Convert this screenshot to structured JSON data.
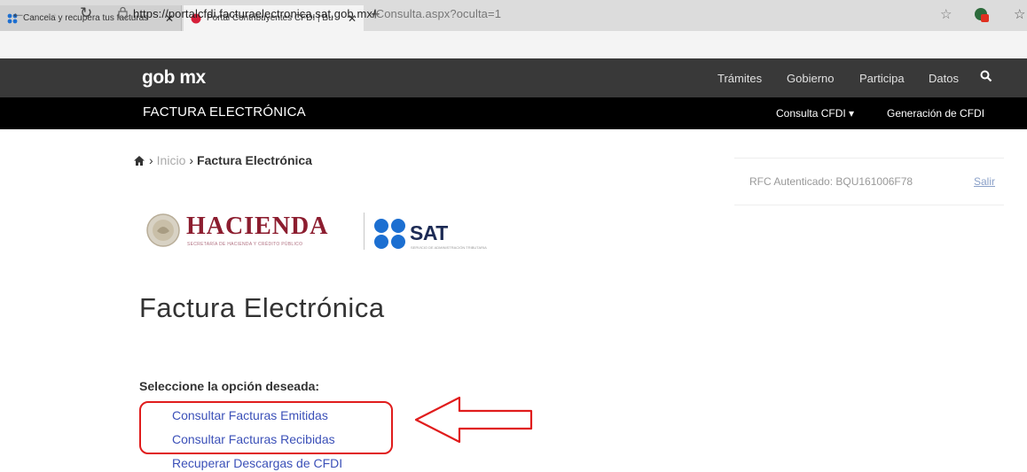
{
  "browser": {
    "tabs": [
      {
        "title": "Cancela y recupera tus facturas",
        "active": false
      },
      {
        "title": "Portal Contribuyentes CFDI | Bu",
        "active": true
      }
    ],
    "new_tab_label": "+",
    "url_main": "https://portalcfdi.facturaelectronica.sat.gob.mx/",
    "url_rest": "Consulta.aspx?oculta=1"
  },
  "gob": {
    "logo": "gob mx",
    "menu": [
      "Trámites",
      "Gobierno",
      "Participa",
      "Datos"
    ]
  },
  "subnav": {
    "title": "FACTURA ELECTRÓNICA",
    "menu": [
      "Consulta CFDI",
      "Generación de CFDI"
    ]
  },
  "breadcrumb": {
    "items": [
      "Inicio",
      "Factura Electrónica"
    ]
  },
  "session": {
    "rfc_text": "RFC Autenticado: BQU161006F78",
    "logout_label": "Salir"
  },
  "logos": {
    "hacienda": "HACIENDA",
    "hacienda_sub": "SECRETARÍA DE HACIENDA Y CRÉDITO PÚBLICO",
    "sat": "SAT",
    "sat_sub": "SERVICIO DE ADMINISTRACIÓN TRIBUTARIA"
  },
  "page": {
    "title": "Factura Electrónica",
    "select_label": "Seleccione la opción deseada:",
    "options": [
      "Consultar Facturas Emitidas",
      "Consultar Facturas Recibidas",
      "Recuperar Descargas de CFDI"
    ]
  },
  "colors": {
    "gob_bar": "#393939",
    "subnav_bar": "#000000",
    "hacienda": "#8c1d2f",
    "sat_blue": "#1c6fd1",
    "link": "#3b50b8",
    "annotation": "#e01c1c"
  }
}
